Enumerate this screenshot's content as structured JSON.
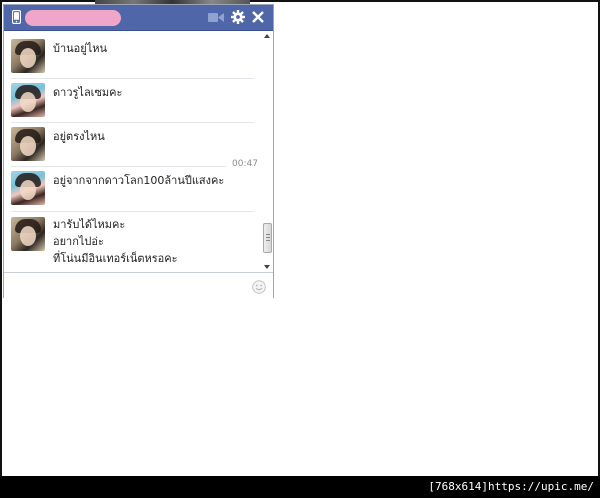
{
  "colors": {
    "header": "#4f66a8",
    "name_blur": "#f0a6c8",
    "text": "#222222",
    "timestamp": "#8a8d91"
  },
  "chat": {
    "header_icons": [
      "phone-icon",
      "video-icon",
      "gear-icon",
      "close-icon"
    ],
    "messages": [
      {
        "sender": "a",
        "lines": [
          "บ้านอยู่ไหน"
        ]
      },
      {
        "sender": "b",
        "lines": [
          "ดาวรูไลเซมคะ"
        ]
      },
      {
        "sender": "a",
        "lines": [
          "อยู่ตรงไหน"
        ]
      },
      {
        "sender": "b",
        "lines": [
          "อยู่จากจากดาวโลก100ล้านปีแสงคะ"
        ]
      },
      {
        "sender": "a",
        "lines": [
          "มารับได้ไหมคะ",
          "อยากไปอ่ะ",
          "ที่โน่นมีอินเทอร์เน็ตหรอคะ"
        ]
      }
    ],
    "timestamp": "00:47",
    "composer_icon": "emoji-icon"
  },
  "watermark": "[768x614]https://upic.me/"
}
